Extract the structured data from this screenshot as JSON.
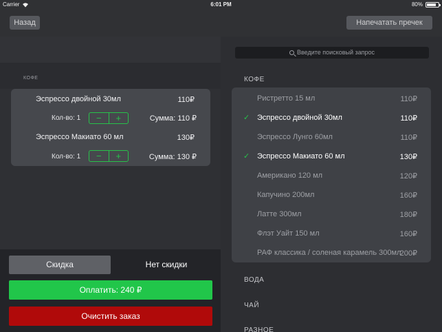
{
  "status": {
    "carrier": "Carrier",
    "time": "6:01 PM",
    "battery": "80%",
    "battery_level": 0.8
  },
  "nav": {
    "back_label": "Назад",
    "print_label": "Напечатать пречек"
  },
  "order": {
    "section_label": "КОФЕ",
    "items": [
      {
        "name": "Эспрессо двойной 30мл",
        "price": "110₽",
        "qty": "Кол-во: 1",
        "sum": "Сумма: 110 ₽"
      },
      {
        "name": "Эспрессо Макиато 60 мл",
        "price": "130₽",
        "qty": "Кол-во: 1",
        "sum": "Сумма: 130 ₽"
      }
    ],
    "stepper": {
      "minus": "−",
      "plus": "+"
    }
  },
  "actions": {
    "discount_label": "Скидка",
    "discount_value": "Нет скидки",
    "pay_label": "Оплатить: 240 ₽",
    "clear_label": "Очистить заказ"
  },
  "menu": {
    "search_placeholder": "Введите поисковый запрос",
    "categories": [
      "КОФЕ",
      "ВОДА",
      "ЧАЙ",
      "РАЗНОЕ"
    ],
    "items": [
      {
        "name": "Ристретто 15 мл",
        "price": "110₽",
        "selected": false
      },
      {
        "name": "Эспрессо двойной 30мл",
        "price": "110₽",
        "selected": true
      },
      {
        "name": "Эспрессо Лунго 60мл",
        "price": "110₽",
        "selected": false
      },
      {
        "name": "Эспрессо Макиато 60 мл",
        "price": "130₽",
        "selected": true
      },
      {
        "name": "Американо 120 мл",
        "price": "120₽",
        "selected": false
      },
      {
        "name": "Капучино 200мл",
        "price": "160₽",
        "selected": false
      },
      {
        "name": "Латте 300мл",
        "price": "180₽",
        "selected": false
      },
      {
        "name": "Флэт Уайт 150 мл",
        "price": "160₽",
        "selected": false
      },
      {
        "name": "РАФ классика / соленая карамель 300мл",
        "price": "200₽",
        "selected": false
      }
    ],
    "check_glyph": "✓"
  }
}
